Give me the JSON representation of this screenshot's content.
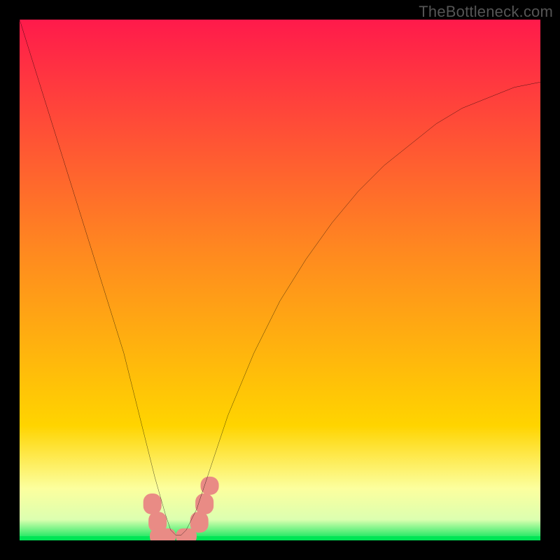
{
  "watermark": "TheBottleneck.com",
  "chart_data": {
    "type": "line",
    "title": "",
    "xlabel": "",
    "ylabel": "",
    "xlim": [
      0,
      100
    ],
    "ylim": [
      0,
      100
    ],
    "grid": false,
    "legend": false,
    "background_gradient": {
      "top_color": "#ff1a4b",
      "mid_color": "#ffd400",
      "bottom_band_color": "#fcff9e",
      "bottom_line_color": "#00e556"
    },
    "series": [
      {
        "name": "bottleneck-curve",
        "color": "#000000",
        "x": [
          0,
          5,
          10,
          15,
          20,
          24,
          26,
          28,
          29,
          30,
          31,
          32,
          34,
          36,
          40,
          45,
          50,
          55,
          60,
          65,
          70,
          75,
          80,
          85,
          90,
          95,
          100
        ],
        "values": [
          100,
          84,
          68,
          52,
          36,
          20,
          12,
          5,
          2,
          1,
          1,
          2,
          6,
          12,
          24,
          36,
          46,
          54,
          61,
          67,
          72,
          76,
          80,
          83,
          85,
          87,
          88
        ]
      }
    ],
    "markers": [
      {
        "shape": "rounded-rect",
        "color": "#e98b85",
        "x": 25.5,
        "y": 7,
        "w": 3.5,
        "h": 4
      },
      {
        "shape": "rounded-rect",
        "color": "#e98b85",
        "x": 26.5,
        "y": 3.5,
        "w": 3.5,
        "h": 4
      },
      {
        "shape": "rounded-rect",
        "color": "#e98b85",
        "x": 27.5,
        "y": 0.8,
        "w": 5,
        "h": 3
      },
      {
        "shape": "rounded-rect",
        "color": "#e98b85",
        "x": 32,
        "y": 0.8,
        "w": 4,
        "h": 3
      },
      {
        "shape": "rounded-rect",
        "color": "#e98b85",
        "x": 34.5,
        "y": 3.5,
        "w": 3.5,
        "h": 4
      },
      {
        "shape": "rounded-rect",
        "color": "#e98b85",
        "x": 35.5,
        "y": 7,
        "w": 3.5,
        "h": 4
      },
      {
        "shape": "rounded-rect",
        "color": "#e98b85",
        "x": 36.5,
        "y": 10.5,
        "w": 3.5,
        "h": 3.5
      }
    ],
    "notes": "V-shaped bottleneck curve. Minimum (optimal match) around x≈30 where value≈0–1. No axis tick labels are visible in the source image; x and y values are normalized estimates on a 0–100 scale."
  }
}
